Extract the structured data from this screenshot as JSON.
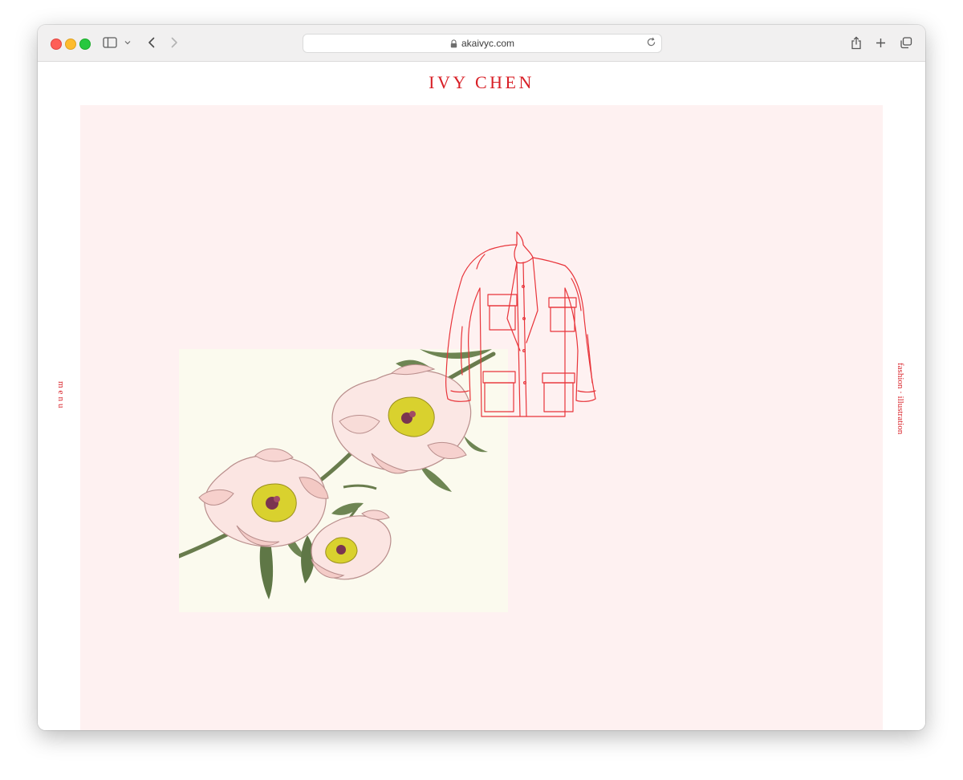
{
  "browser": {
    "url": "akaivyc.com",
    "icons": {
      "sidebar": "sidebar-icon",
      "chevron": "chevron-down-icon",
      "back": "back-arrow-icon",
      "forward": "forward-arrow-icon",
      "lock": "lock-icon",
      "reload": "reload-icon",
      "share": "share-icon",
      "new_tab": "plus-icon",
      "tabs": "tab-overview-icon"
    }
  },
  "site": {
    "title": "IVY CHEN",
    "menu_label": "menu",
    "tagline": "fashion · illustration"
  },
  "colors": {
    "accent": "#d81f26",
    "stage_background": "#fef1f1",
    "flower_paper": "#fbfaee",
    "jacket_stroke": "#e8343a"
  }
}
